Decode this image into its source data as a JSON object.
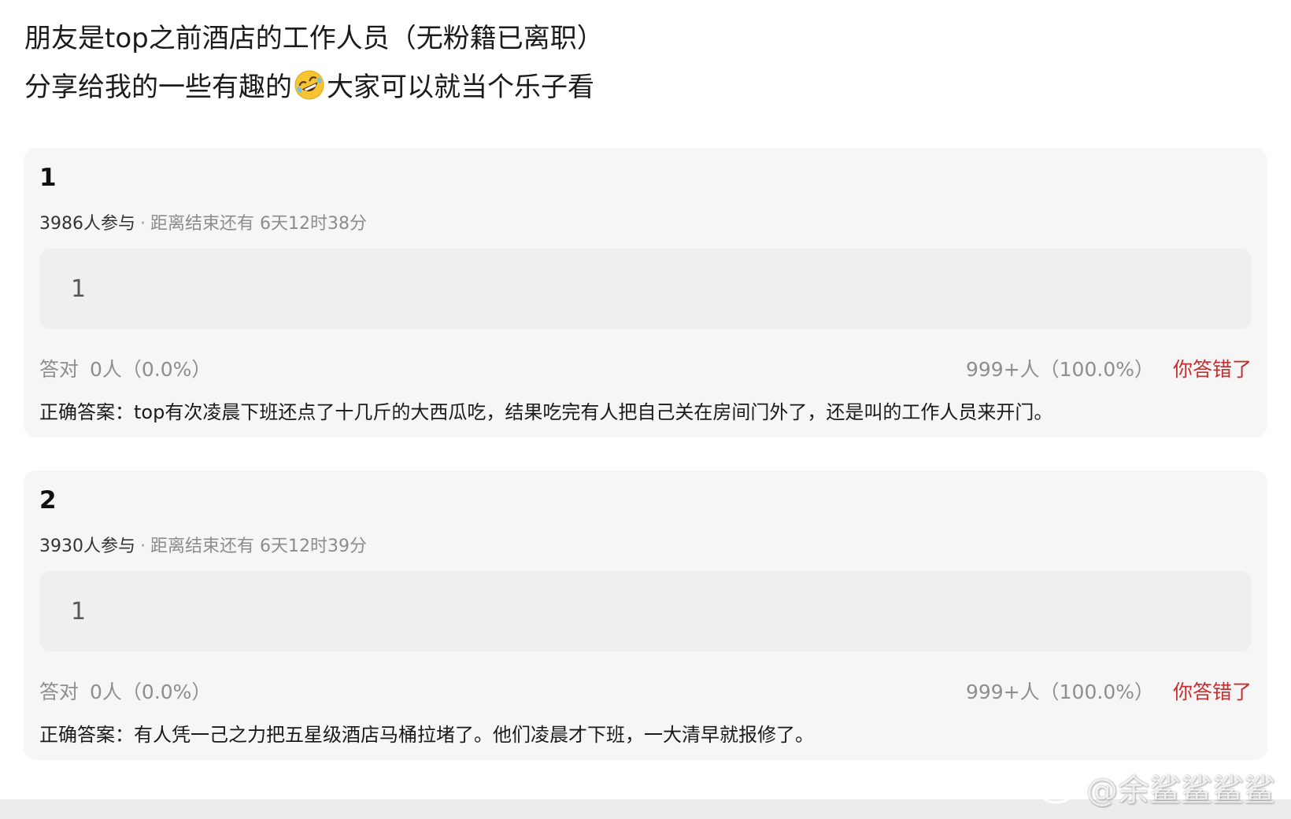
{
  "intro": {
    "line1": "朋友是top之前酒店的工作人员（无粉籍已离职）",
    "line2_before": "分享给我的一些有趣的",
    "line2_emoji": "rolling-on-floor-laughing-emoji",
    "line2_after": "大家可以就当个乐子看"
  },
  "quizzes": [
    {
      "number": "1",
      "participants": "3986人参与",
      "separator": "·",
      "deadline": "距离结束还有 6天12时38分",
      "option": "1",
      "correct_label": "答对",
      "correct_count": "0人（0.0%）",
      "wrong_count": "999+人（100.0%）",
      "verdict": "你答错了",
      "answer": "正确答案：top有次凌晨下班还点了十几斤的大西瓜吃，结果吃完有人把自己关在房间门外了，还是叫的工作人员来开门。"
    },
    {
      "number": "2",
      "participants": "3930人参与",
      "separator": "·",
      "deadline": "距离结束还有 6天12时39分",
      "option": "1",
      "correct_label": "答对",
      "correct_count": "0人（0.0%）",
      "wrong_count": "999+人（100.0%）",
      "verdict": "你答错了",
      "answer": "正确答案：有人凭一己之力把五星级酒店马桶拉堵了。他们凌晨才下班，一大清早就报修了。"
    }
  ],
  "watermark": {
    "icon": "weibo-logo-icon",
    "handle": "@余鲨鲨鲨鲨"
  },
  "colors": {
    "card_bg": "#f6f6f6",
    "option_bg": "#efefef",
    "wrong_verdict": "#c62f2f",
    "muted_text": "#8e8e8e"
  }
}
